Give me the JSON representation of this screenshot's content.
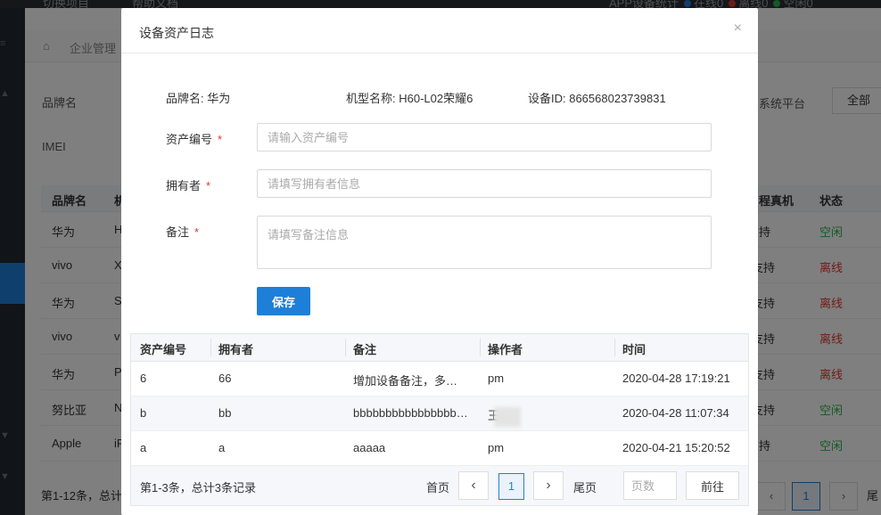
{
  "topbar": {
    "switch_project": "切换项目",
    "help_docs": "帮助文档",
    "stats_label": "APP设备统计",
    "online": "在线0",
    "offline": "离线0",
    "idle": "空闲0",
    "colors": {
      "online": "#1e7fd9",
      "offline": "#e0392d",
      "idle": "#2bb24c"
    }
  },
  "breadcrumb": {
    "text": "企业管理"
  },
  "filters": {
    "brand_label": "品牌名",
    "imei_label": "IMEI",
    "platform_label": "系统平台",
    "platform_value": "全部"
  },
  "background_table": {
    "headers": {
      "brand": "品牌名",
      "model_initial": "机",
      "remote": "程真机",
      "status": "状态"
    },
    "rows": [
      {
        "brand": "华为",
        "model_initial": "H",
        "remote": "持",
        "status": "空闲"
      },
      {
        "brand": "vivo",
        "model_initial": "X",
        "remote": "支持",
        "status": "离线"
      },
      {
        "brand": "华为",
        "model_initial": "S",
        "remote": "支持",
        "status": "离线"
      },
      {
        "brand": "vivo",
        "model_initial": "v",
        "remote": "支持",
        "status": "离线"
      },
      {
        "brand": "华为",
        "model_initial": "P",
        "remote": "支持",
        "status": "离线"
      },
      {
        "brand": "努比亚",
        "model_initial": "N",
        "remote": "支持",
        "status": "空闲"
      },
      {
        "brand": "Apple",
        "model_initial": "iP",
        "remote": "持",
        "status": "空闲"
      }
    ],
    "footer": "第1-12条，总计",
    "current_page": "1",
    "last_text": "尾"
  },
  "modal": {
    "title": "设备资产日志",
    "close": "×",
    "brand_info": "品牌名: 华为",
    "model_info": "机型名称: H60-L02荣耀6",
    "device_id_info": "设备ID: 866568023739831",
    "asset_no": {
      "label": "资产编号",
      "required": "*",
      "placeholder": "请输入资产编号",
      "value": ""
    },
    "owner": {
      "label": "拥有者",
      "required": "*",
      "placeholder": "请填写拥有者信息",
      "value": ""
    },
    "remark": {
      "label": "备注",
      "required": "*",
      "placeholder": "请填写备注信息",
      "value": ""
    },
    "save_label": "保存",
    "table": {
      "headers": [
        "资产编号",
        "拥有者",
        "备注",
        "操作者",
        "时间"
      ],
      "rows": [
        {
          "asset": "6",
          "owner": "66",
          "remark": "增加设备备注，多添加几个字符看看效果",
          "operator": "pm",
          "time": "2020-04-28 17:19:21"
        },
        {
          "asset": "b",
          "owner": "bb",
          "remark": "bbbbbbbbbbbbbbbbbbbbbbbbb",
          "operator": "王",
          "time": "2020-04-28 11:07:34"
        },
        {
          "asset": "a",
          "owner": "a",
          "remark": "aaaaa",
          "operator": "pm",
          "time": "2020-04-21 15:20:52"
        }
      ]
    },
    "pagination": {
      "summary": "第1-3条，总计3条记录",
      "first": "首页",
      "prev_icon": "‹",
      "current": "1",
      "next_icon": "›",
      "last": "尾页",
      "page_input_placeholder": "页数",
      "go_label": "前往"
    }
  }
}
